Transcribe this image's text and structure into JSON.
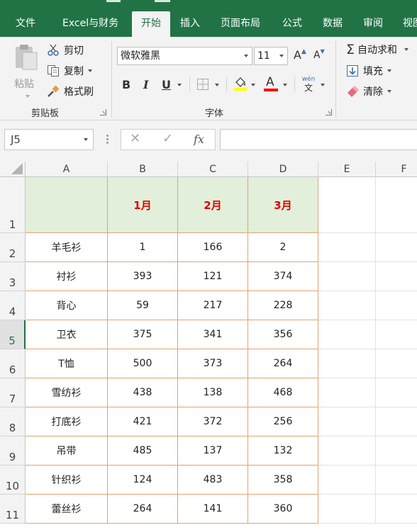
{
  "tabs": [
    {
      "label": "文件",
      "active": false
    },
    {
      "label": "Excel与财务",
      "active": false
    },
    {
      "label": "开始",
      "active": true
    },
    {
      "label": "插入",
      "active": false
    },
    {
      "label": "页面布局",
      "active": false
    },
    {
      "label": "公式",
      "active": false
    },
    {
      "label": "数据",
      "active": false
    },
    {
      "label": "审阅",
      "active": false
    },
    {
      "label": "视图",
      "active": false
    }
  ],
  "clipboard": {
    "paste_label": "粘贴",
    "cut_label": "剪切",
    "copy_label": "复制",
    "format_painter_label": "格式刷",
    "group_label": "剪贴板"
  },
  "font": {
    "font_name": "微软雅黑",
    "font_size": "11",
    "bold": "B",
    "italic": "I",
    "underline": "U",
    "group_label": "字体",
    "pinyin_top": "wén",
    "pinyin_char": "文",
    "font_color_glyph": "A",
    "grow_glyph": "A",
    "shrink_glyph": "A"
  },
  "editing": {
    "autosum_label": "自动求和",
    "fill_label": "填充",
    "clear_label": "清除",
    "sigma": "Σ"
  },
  "formula_bar": {
    "name_box": "J5",
    "cancel": "✕",
    "enter": "✓",
    "fx": "fx",
    "formula": ""
  },
  "columns": [
    "A",
    "B",
    "C",
    "D",
    "E",
    "F"
  ],
  "header_row": {
    "row": "1",
    "a": "",
    "b": "1月",
    "c": "2月",
    "d": "3月"
  },
  "rows": [
    {
      "row": "2",
      "a": "羊毛衫",
      "b": "1",
      "c": "166",
      "d": "2"
    },
    {
      "row": "3",
      "a": "衬衫",
      "b": "393",
      "c": "121",
      "d": "374"
    },
    {
      "row": "4",
      "a": "背心",
      "b": "59",
      "c": "217",
      "d": "228"
    },
    {
      "row": "5",
      "a": "卫衣",
      "b": "375",
      "c": "341",
      "d": "356"
    },
    {
      "row": "6",
      "a": "T恤",
      "b": "500",
      "c": "373",
      "d": "264"
    },
    {
      "row": "7",
      "a": "雪纺衫",
      "b": "438",
      "c": "138",
      "d": "468"
    },
    {
      "row": "8",
      "a": "打底衫",
      "b": "421",
      "c": "372",
      "d": "256"
    },
    {
      "row": "9",
      "a": "吊带",
      "b": "485",
      "c": "137",
      "d": "132"
    },
    {
      "row": "10",
      "a": "针织衫",
      "b": "124",
      "c": "483",
      "d": "358"
    },
    {
      "row": "11",
      "a": "蕾丝衫",
      "b": "264",
      "c": "141",
      "d": "360"
    }
  ],
  "selected_row": "5",
  "colors": {
    "excel_green": "#217346",
    "header_fill": "#e2efda",
    "header_text": "#e00000",
    "border_orange": "#e0a46e",
    "highlight_yellow": "#ffff00",
    "font_red": "#ff0000"
  }
}
